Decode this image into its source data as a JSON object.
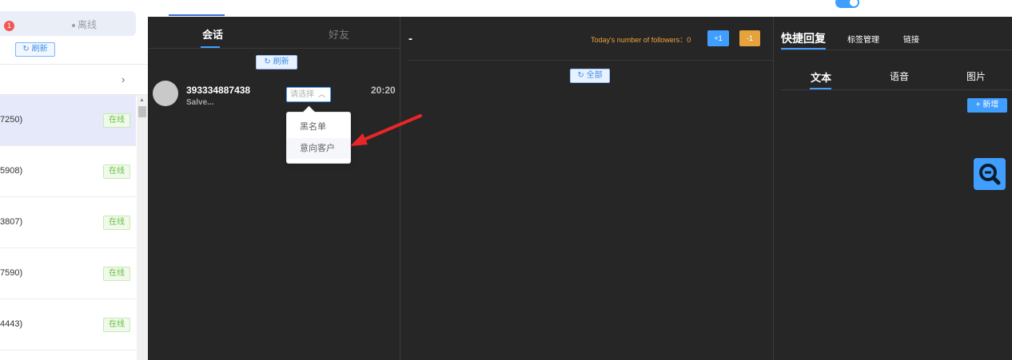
{
  "left_panel": {
    "badge_count": "1",
    "offline_label": "离线",
    "refresh_label": "↻ 刷新",
    "chevron": "›",
    "devices": [
      {
        "id": "7250)",
        "status": "在线",
        "active": true
      },
      {
        "id": "5908)",
        "status": "在线",
        "active": false
      },
      {
        "id": "3807)",
        "status": "在线",
        "active": false
      },
      {
        "id": "7590)",
        "status": "在线",
        "active": false
      },
      {
        "id": "4443)",
        "status": "在线",
        "active": false
      }
    ]
  },
  "sessions_panel": {
    "tabs": [
      "会话",
      "好友"
    ],
    "refresh_label": "↻ 刷新",
    "chat": {
      "phone": "393334887438",
      "preview": "Salve...",
      "time": "20:20",
      "select_placeholder": "请选择"
    },
    "dropdown_options": [
      "黑名单",
      "意向客户"
    ]
  },
  "main_panel": {
    "title": "-",
    "followers_text": "Today's number of followers：0",
    "plus_label": "+1",
    "minus_label": "-1",
    "all_label": "↻ 全部"
  },
  "right_panel": {
    "tabs": [
      "快捷回复",
      "标签管理",
      "链接"
    ],
    "sub_tabs": [
      "文本",
      "语音",
      "图片"
    ],
    "new_label": "+ 新增"
  },
  "colors": {
    "accent": "#409eff",
    "warning": "#e6a23c",
    "dark_panel": "#262626",
    "success": "#67c23a",
    "annotation_arrow": "#e8262a"
  }
}
